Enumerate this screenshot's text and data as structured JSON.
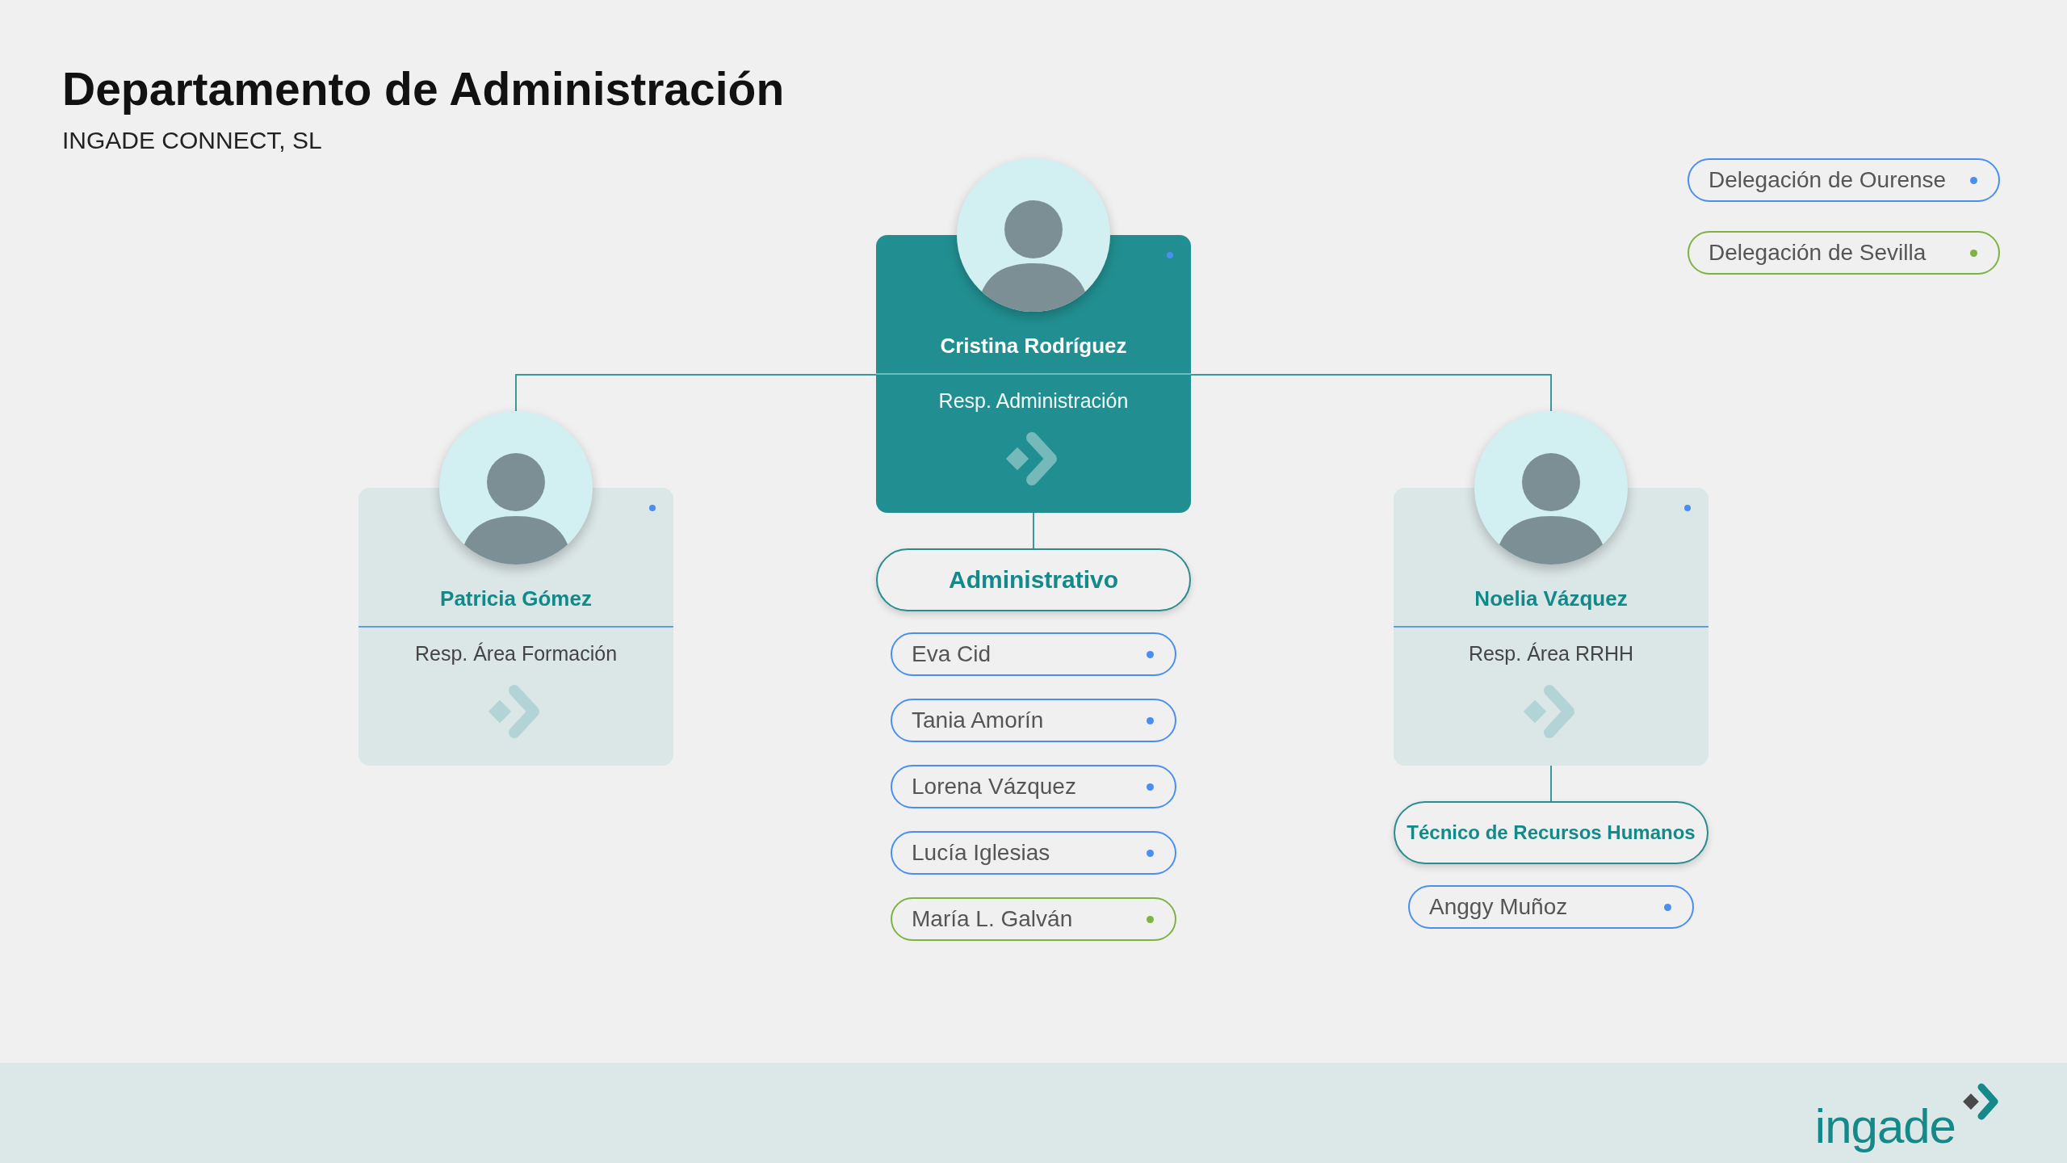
{
  "header": {
    "title": "Departamento de Administración",
    "subtitle": "INGADE CONNECT, SL"
  },
  "delegations": [
    {
      "label": "Delegación de Ourense",
      "color": "#4a8ff0"
    },
    {
      "label": "Delegación de Sevilla",
      "color": "#7cb342"
    }
  ],
  "org_chart": {
    "columns": [
      {
        "card": {
          "kind": "secondary",
          "name": "Patricia Gómez",
          "role": "Resp. Área Formación",
          "color": "#4a8ff0"
        }
      },
      {
        "card": {
          "kind": "primary",
          "name": "Cristina Rodríguez",
          "role": "Resp. Administración",
          "color": "#4a8ff0"
        },
        "team": {
          "title": "Administrativo",
          "members": [
            {
              "name": "Eva Cid",
              "color": "#4a8ff0"
            },
            {
              "name": "Tania Amorín",
              "color": "#4a8ff0"
            },
            {
              "name": "Lorena Vázquez",
              "color": "#4a8ff0"
            },
            {
              "name": "Lucía Iglesias",
              "color": "#4a8ff0"
            },
            {
              "name": "María L. Galván",
              "color": "#7cb342"
            }
          ]
        }
      },
      {
        "card": {
          "kind": "secondary",
          "name": "Noelia Vázquez",
          "role": "Resp. Área RRHH",
          "color": "#4a8ff0"
        },
        "team": {
          "title": "Técnico de Recursos Humanos",
          "members": [
            {
              "name": "Anggy Muñoz",
              "color": "#4a8ff0"
            }
          ]
        }
      }
    ]
  },
  "footer": {
    "logo": "ingade"
  }
}
